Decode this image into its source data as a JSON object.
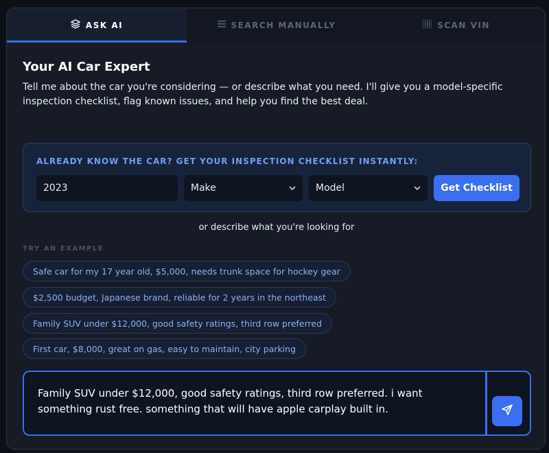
{
  "tabs": [
    {
      "label": "ASK AI",
      "icon": "layers-icon",
      "active": true
    },
    {
      "label": "SEARCH MANUALLY",
      "icon": "list-icon",
      "active": false
    },
    {
      "label": "SCAN VIN",
      "icon": "barcode-icon",
      "active": false
    }
  ],
  "header": {
    "title": "Your AI Car Expert",
    "description": "Tell me about the car you're considering — or describe what you need. I'll give you a model-specific inspection checklist, flag known issues, and help you find the best deal."
  },
  "quick_checklist": {
    "label": "ALREADY KNOW THE CAR? GET YOUR INSPECTION CHECKLIST INSTANTLY:",
    "year_value": "2023",
    "make_value": "Make",
    "model_value": "Model",
    "button_label": "Get Checklist"
  },
  "divider_text": "or describe what you're looking for",
  "examples": {
    "label": "TRY AN EXAMPLE",
    "items": [
      "Safe car for my 17 year old, $5,000, needs trunk space for hockey gear",
      "$2,500 budget, Japanese brand, reliable for 2 years in the northeast",
      "Family SUV under $12,000, good safety ratings, third row preferred",
      "First car, $8,000, great on gas, easy to maintain, city parking"
    ]
  },
  "composer": {
    "value": "Family SUV under $12,000, good safety ratings, third row preferred. i want something rust free. something that will have apple carplay built in.",
    "send_icon": "send-icon"
  },
  "colors": {
    "accent": "#3b6ef0",
    "background": "#161b25",
    "chip_text": "#8fb0f0",
    "label_blue": "#6f9ef5"
  }
}
